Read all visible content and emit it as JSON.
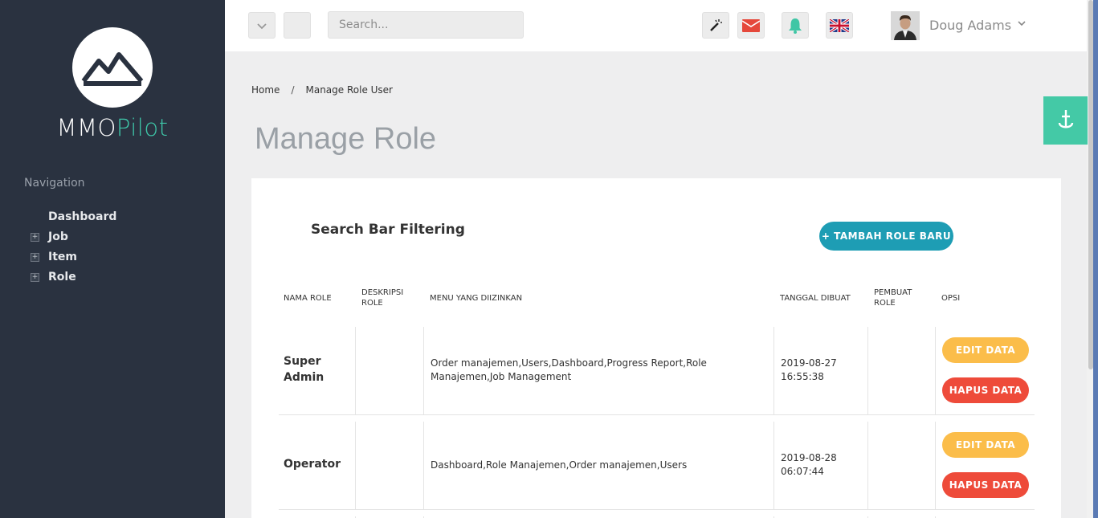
{
  "brand": {
    "name_main": "MMO",
    "name_accent": "Pilot"
  },
  "sidebar": {
    "heading": "Navigation",
    "items": [
      {
        "label": "Dashboard",
        "expandable": false
      },
      {
        "label": "Job",
        "expandable": true
      },
      {
        "label": "Item",
        "expandable": true
      },
      {
        "label": "Role",
        "expandable": true
      }
    ],
    "expand_symbol": "+"
  },
  "topbar": {
    "search_placeholder": "Search...",
    "icons": [
      "chevron-down-icon",
      "magic-wand-icon",
      "envelope-icon",
      "bell-icon",
      "uk-flag-icon"
    ],
    "user": {
      "name": "Doug Adams"
    }
  },
  "breadcrumb": {
    "home": "Home",
    "separator": "/",
    "current": "Manage Role User"
  },
  "page": {
    "title": "Manage Role"
  },
  "card": {
    "title": "Search Bar Filtering",
    "add_button": "+ TAMBAH ROLE BARU"
  },
  "table": {
    "headers": {
      "nama_role": "NAMA ROLE",
      "deskripsi_1": "DESKRIPSI",
      "deskripsi_2": "ROLE",
      "menu": "MENU YANG DIIZINKAN",
      "tanggal": "TANGGAL DIBUAT",
      "pembuat_1": "PEMBUAT",
      "pembuat_2": "ROLE",
      "opsi": "OPSI"
    },
    "rows": [
      {
        "role_1": "Super",
        "role_2": "Admin",
        "deskripsi": "",
        "menu_1": "Order manajemen,Users,Dashboard,Progress Report,Role",
        "menu_2": "Manajemen,Job Management",
        "date": "2019-08-27",
        "time": "16:55:38",
        "pembuat": "",
        "edit": "EDIT DATA",
        "hapus": "HAPUS DATA"
      },
      {
        "role_1": "Operator",
        "role_2": "",
        "deskripsi": "",
        "menu_1": "Dashboard,Role Manajemen,Order manajemen,Users",
        "menu_2": "",
        "date": "2019-08-28",
        "time": "06:07:44",
        "pembuat": "",
        "edit": "EDIT DATA",
        "hapus": "HAPUS DATA"
      }
    ]
  },
  "colors": {
    "sidebar_bg": "#2a3240",
    "brand_accent": "#3ec6a8",
    "primary_button": "#1e9db4",
    "edit_button": "#fbbd4a",
    "delete_button": "#ee4b3a",
    "float_button": "#44c9a6"
  }
}
